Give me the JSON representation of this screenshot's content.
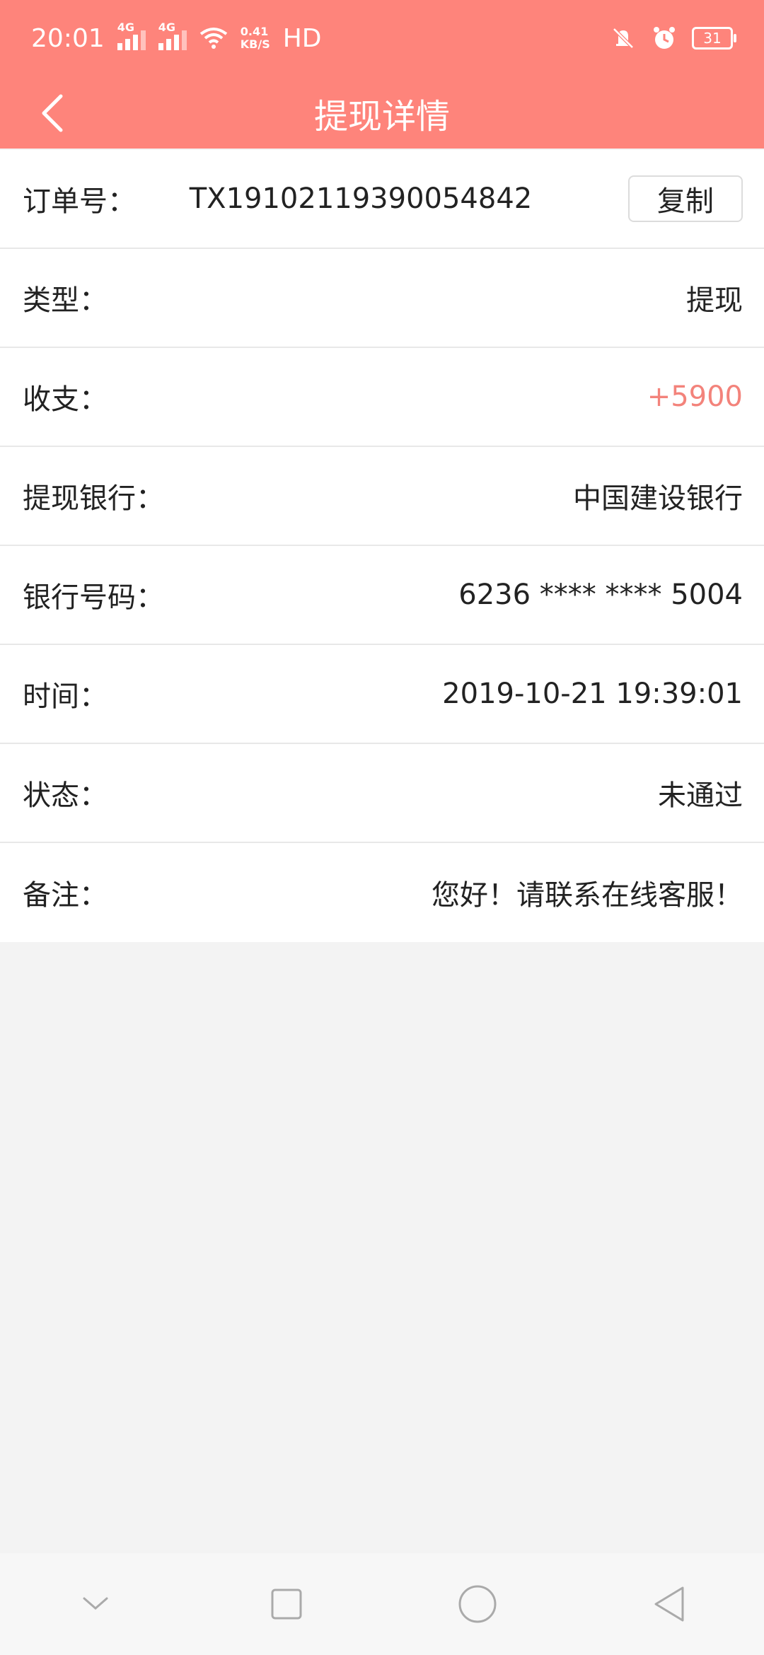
{
  "status_bar": {
    "time": "20:01",
    "network1": "4G",
    "network2": "4G",
    "speed_value": "0.41",
    "speed_unit": "KB/S",
    "hd": "HD",
    "battery": "31",
    "icons": [
      "signal-icon",
      "wifi-icon",
      "mute-icon",
      "alarm-icon",
      "battery-icon"
    ]
  },
  "header": {
    "title": "提现详情",
    "back_icon": "chevron-left-icon",
    "bg_color": "#fe847b"
  },
  "details": {
    "order": {
      "label": "订单号：",
      "value": "TX19102119390054842",
      "copy_label": "复制"
    },
    "type": {
      "label": "类型：",
      "value": "提现"
    },
    "amount": {
      "label": "收支：",
      "value": "+5900",
      "color": "#f3837b"
    },
    "bank": {
      "label": "提现银行：",
      "value": "中国建设银行"
    },
    "card": {
      "label": "银行号码：",
      "value": "6236 **** **** 5004"
    },
    "time": {
      "label": "时间：",
      "value": "2019-10-21 19:39:01"
    },
    "status": {
      "label": "状态：",
      "value": "未通过"
    },
    "remark": {
      "label": "备注：",
      "value": "您好！请联系在线客服！"
    }
  },
  "nav_bar": {
    "icons": [
      "collapse-icon",
      "recent-apps-icon",
      "home-icon",
      "back-icon"
    ]
  }
}
